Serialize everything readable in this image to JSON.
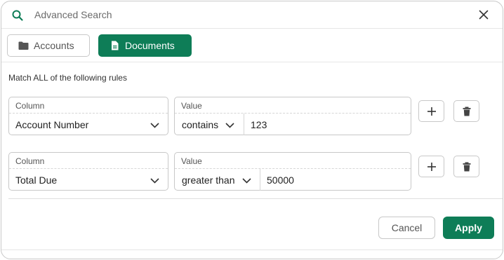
{
  "header": {
    "title": "Advanced Search",
    "search_icon": "search-icon",
    "close_icon": "close-icon"
  },
  "tabs": [
    {
      "label": "Accounts",
      "icon": "folder-icon",
      "active": false
    },
    {
      "label": "Documents",
      "icon": "document-icon",
      "active": true
    }
  ],
  "match_text": "Match ALL of the following rules",
  "rules": [
    {
      "column_label": "Column",
      "column_value": "Account Number",
      "value_label": "Value",
      "operator": "contains",
      "value": "123"
    },
    {
      "column_label": "Column",
      "column_value": "Total Due",
      "value_label": "Value",
      "operator": "greater than",
      "value": "50000"
    }
  ],
  "footer": {
    "cancel_label": "Cancel",
    "apply_label": "Apply"
  },
  "colors": {
    "accent": "#0e7d57",
    "border": "#c8c8c8"
  }
}
